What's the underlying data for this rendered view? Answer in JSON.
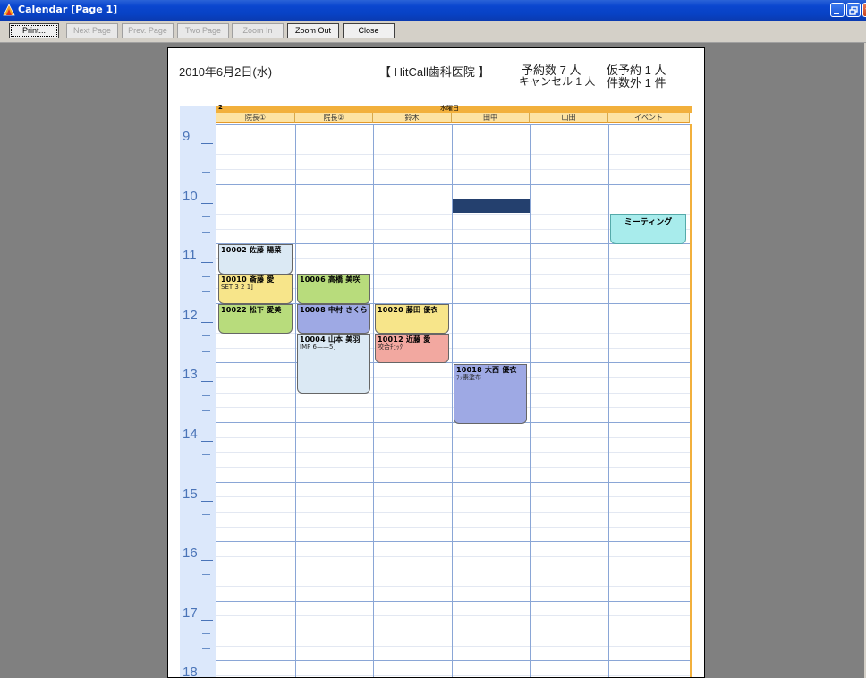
{
  "window": {
    "title": "Calendar [Page 1]",
    "accent": "#0a46cf"
  },
  "toolbar": {
    "print": "Print...",
    "next_page": "Next Page",
    "prev_page": "Prev. Page",
    "two_page": "Two Page",
    "zoom_in": "Zoom In",
    "zoom_out": "Zoom Out",
    "close": "Close"
  },
  "header": {
    "date": "2010年6月2日(水)",
    "clinic": "【 HitCall歯科医院 】",
    "appt_count": "予約数 7 人",
    "cancel_count": "キャンセル 1 人",
    "tentative_count": "仮予約 1 人",
    "other_count": "件数外 1 件"
  },
  "calendar": {
    "day_number": "2",
    "day_name": "水曜日",
    "columns": [
      "院長①",
      "院長②",
      "鈴木",
      "田中",
      "山田",
      "イベント"
    ],
    "hours": [
      "9",
      "10",
      "11",
      "12",
      "13",
      "14",
      "15",
      "16",
      "17",
      "18"
    ],
    "appointments": [
      {
        "col": 0,
        "line1": "10002 佐藤 陽菜",
        "line2": "",
        "color": "#dbe9f4"
      },
      {
        "col": 0,
        "line1": "10010 斎藤 愛",
        "line2": "SET 3 2 1]",
        "color": "#f7e58a"
      },
      {
        "col": 0,
        "line1": "10022 松下 愛美",
        "line2": "",
        "color": "#b8dc7c"
      },
      {
        "col": 1,
        "line1": "10006 高橋 美咲",
        "line2": "",
        "color": "#b8dc7c"
      },
      {
        "col": 1,
        "line1": "10008 中村 さくら",
        "line2": "",
        "color": "#9ea9e4"
      },
      {
        "col": 1,
        "line1": "10004 山本 美羽",
        "line2": "IMP 6——5]",
        "color": "#dbe9f4"
      },
      {
        "col": 2,
        "line1": "10020 藤田 優衣",
        "line2": "",
        "color": "#f7e58a"
      },
      {
        "col": 2,
        "line1": "10012 近藤 愛",
        "line2": "咬合ﾁｪｯｸ",
        "color": "#f2a8a0"
      },
      {
        "col": 3,
        "line1": "10018 大西 優衣",
        "line2": "ﾌｯ素塗布",
        "color": "#9ea9e4"
      }
    ],
    "event": "ミーティング"
  }
}
